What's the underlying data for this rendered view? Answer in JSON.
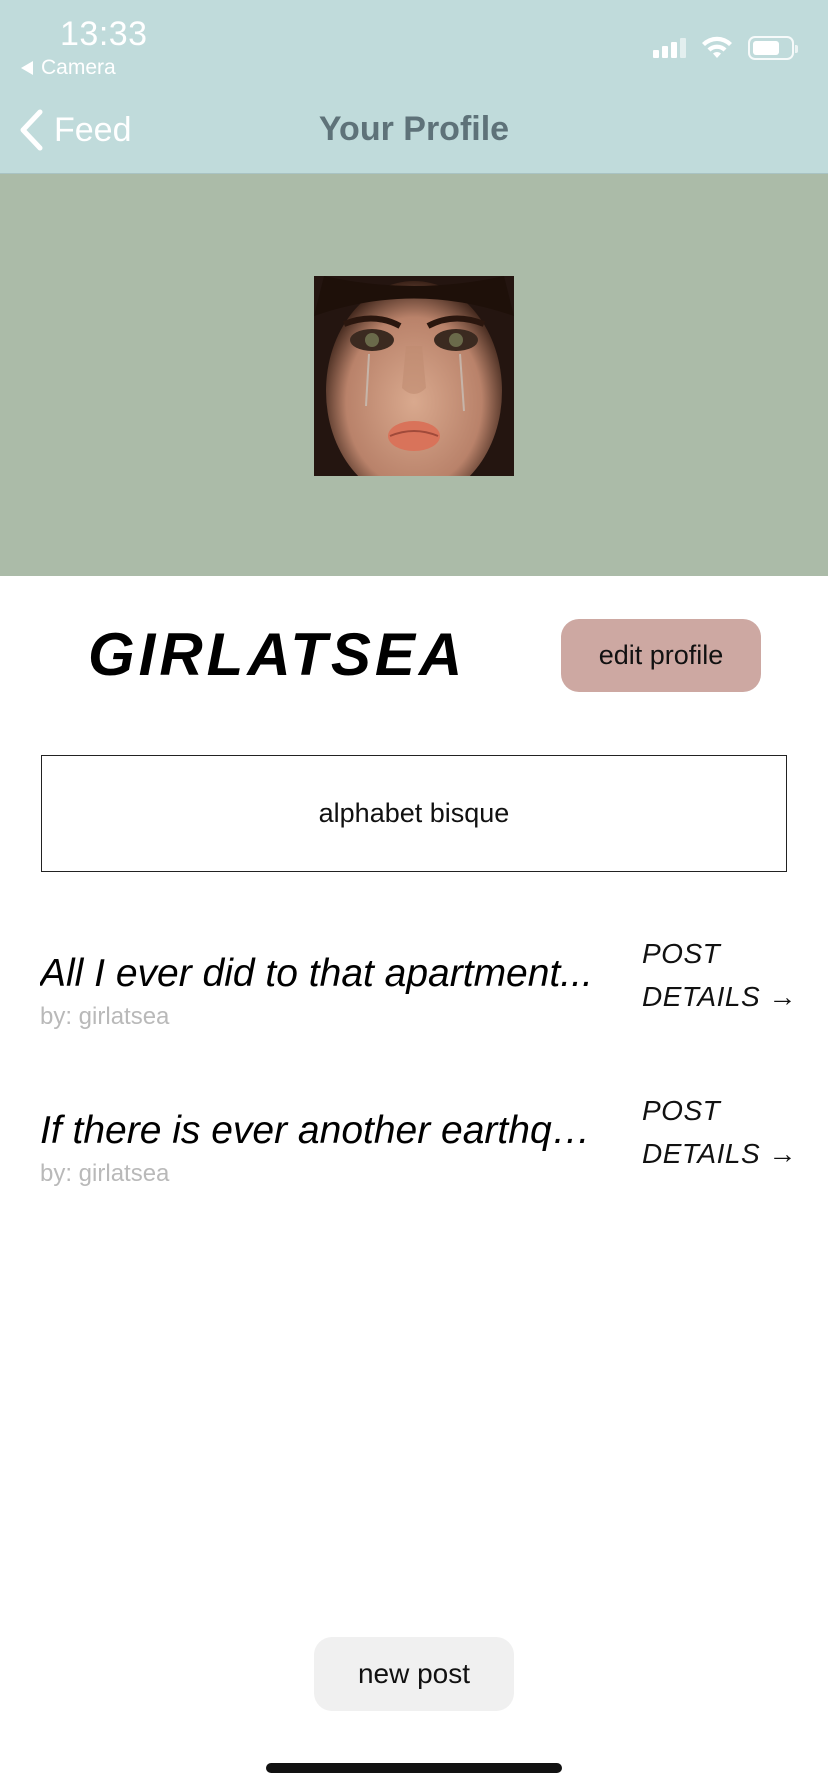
{
  "status_bar": {
    "time": "13:33",
    "back_app": "Camera",
    "signal_icon": "signal-bars-icon",
    "wifi_icon": "wifi-icon",
    "battery_icon": "battery-icon"
  },
  "nav": {
    "back_label": "Feed",
    "title": "Your Profile"
  },
  "profile": {
    "username": "GIRLATSEA",
    "edit_label": "edit profile",
    "bio": "alphabet bisque"
  },
  "posts": [
    {
      "title": "All I ever did to that apartment...",
      "author": "by: girlatsea",
      "details_line1": "POST",
      "details_line2": "DETAILS →"
    },
    {
      "title": "If there is ever another earthquake...",
      "author": "by: girlatsea",
      "details_line1": "POST",
      "details_line2": "DETAILS →"
    }
  ],
  "footer": {
    "new_post_label": "new post"
  },
  "colors": {
    "nav_bg": "#c0dbdb",
    "banner_bg": "#abbba8",
    "edit_button": "#cda8a2",
    "nav_title": "#5e7279"
  }
}
